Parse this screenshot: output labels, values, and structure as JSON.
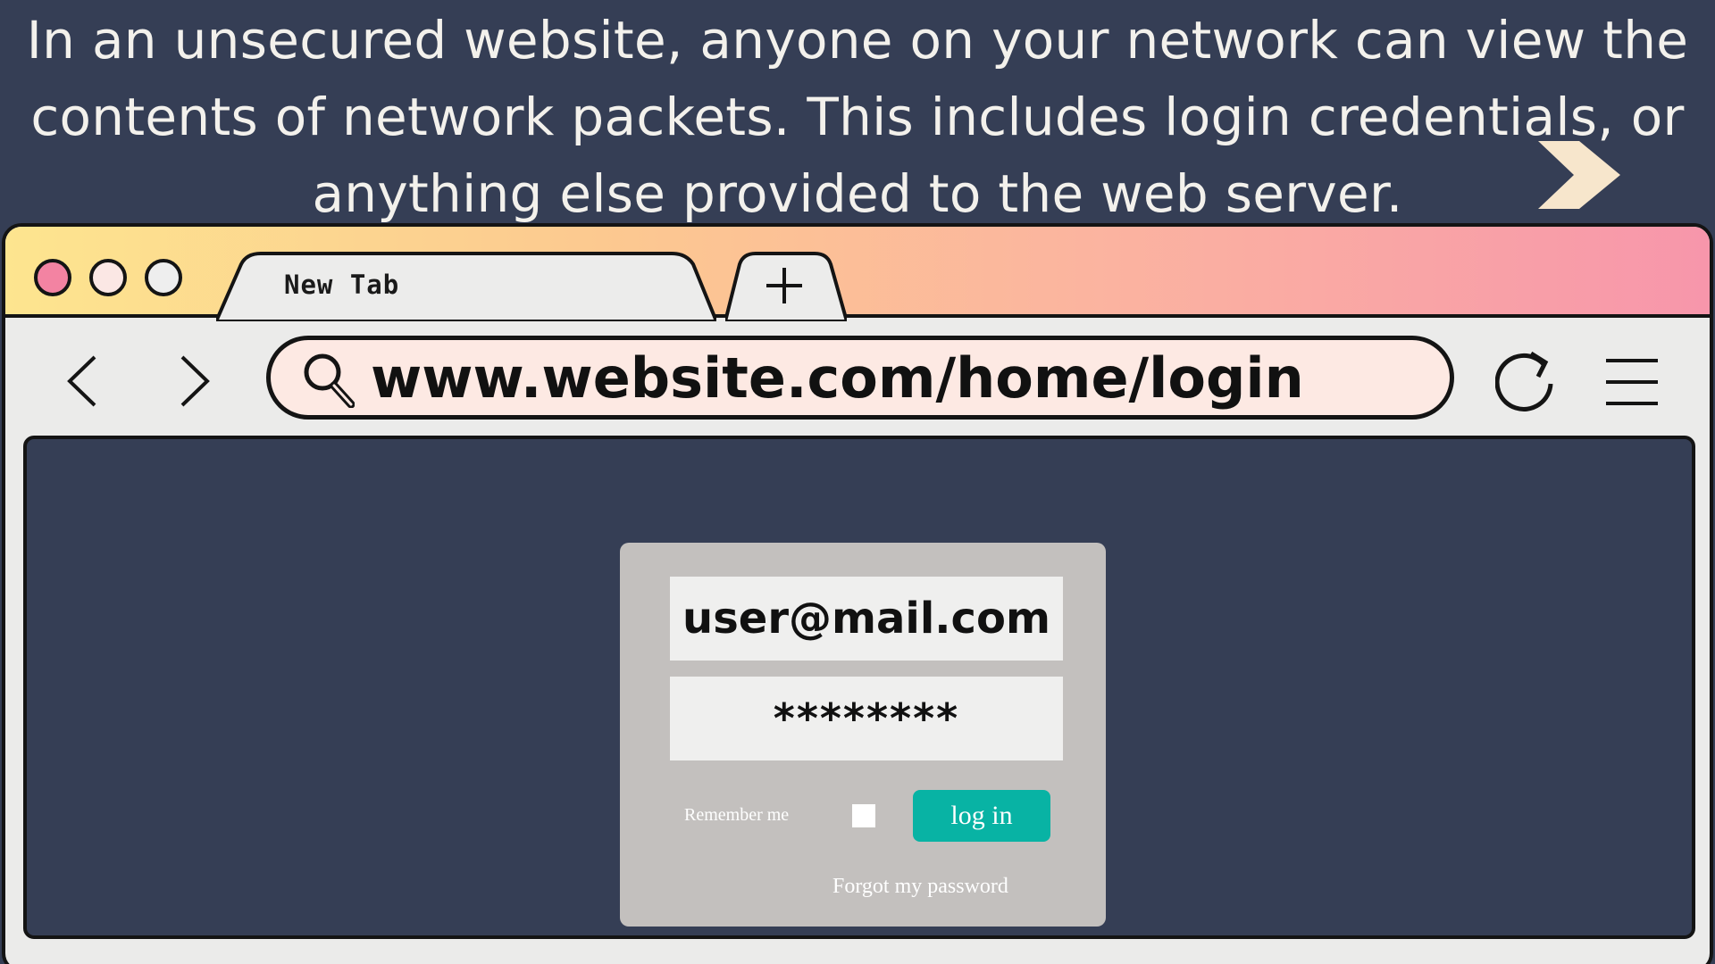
{
  "caption": {
    "line1": "In an unsecured website, anyone on your network can view the",
    "line2": "contents of network packets. This includes login credentials, or",
    "line3": "anything else provided to the web server."
  },
  "icons": {
    "next": "chevron-right-icon",
    "back": "chevron-left-icon",
    "forward": "chevron-right-icon",
    "search": "search-icon",
    "reload": "reload-icon",
    "menu": "hamburger-menu-icon",
    "new_tab": "plus-icon"
  },
  "browser": {
    "window_controls": [
      "close",
      "minimize",
      "maximize"
    ],
    "tab_label": "New Tab",
    "url": "www.website.com/home/login"
  },
  "login": {
    "email_value": "user@mail.com",
    "password_value": "********",
    "remember_label": "Remember me",
    "remember_checked": false,
    "login_button": "log in",
    "forgot_link": "Forgot my password"
  },
  "colors": {
    "background": "#353e55",
    "accent_button": "#08b3a4",
    "titlebar_gradient": [
      "#fde58f",
      "#f796ab"
    ],
    "address_bar": "#fde9e3",
    "card": "#c3c0be"
  }
}
